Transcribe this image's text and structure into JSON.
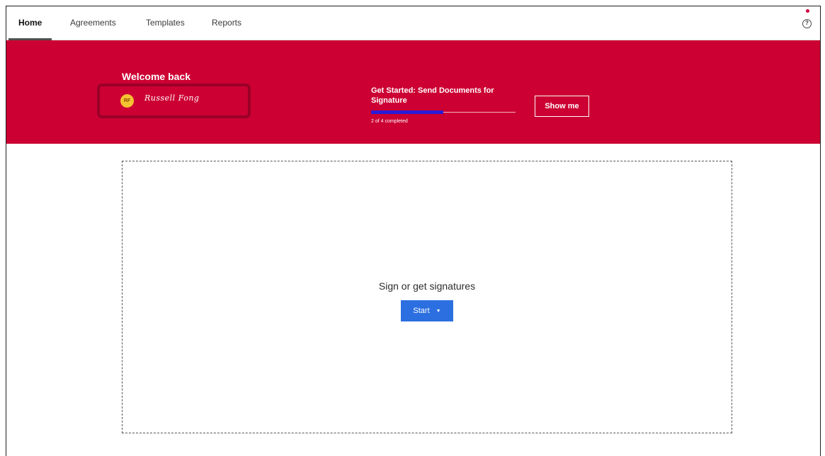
{
  "nav": {
    "tabs": [
      {
        "label": "Home",
        "active": true
      },
      {
        "label": "Agreements",
        "active": false
      },
      {
        "label": "Templates",
        "active": false
      },
      {
        "label": "Reports",
        "active": false
      }
    ],
    "help_icon": "help-circle-icon",
    "help_glyph": "?",
    "notification_color": "#d0003c"
  },
  "banner": {
    "background": "#cc0033",
    "welcome": "Welcome back",
    "avatar_initials": "RF",
    "signature_text": "Russell Fong",
    "get_started_title": "Get Started: Send Documents for Signature",
    "progress_fraction": 0.5,
    "progress_text": "2 of 4 completed",
    "show_me_label": "Show me"
  },
  "main": {
    "drop_title": "Sign or get signatures",
    "start_label": "Start",
    "start_icon": "chevron-down-icon",
    "start_caret": "▼",
    "accent": "#2c6fe0"
  }
}
